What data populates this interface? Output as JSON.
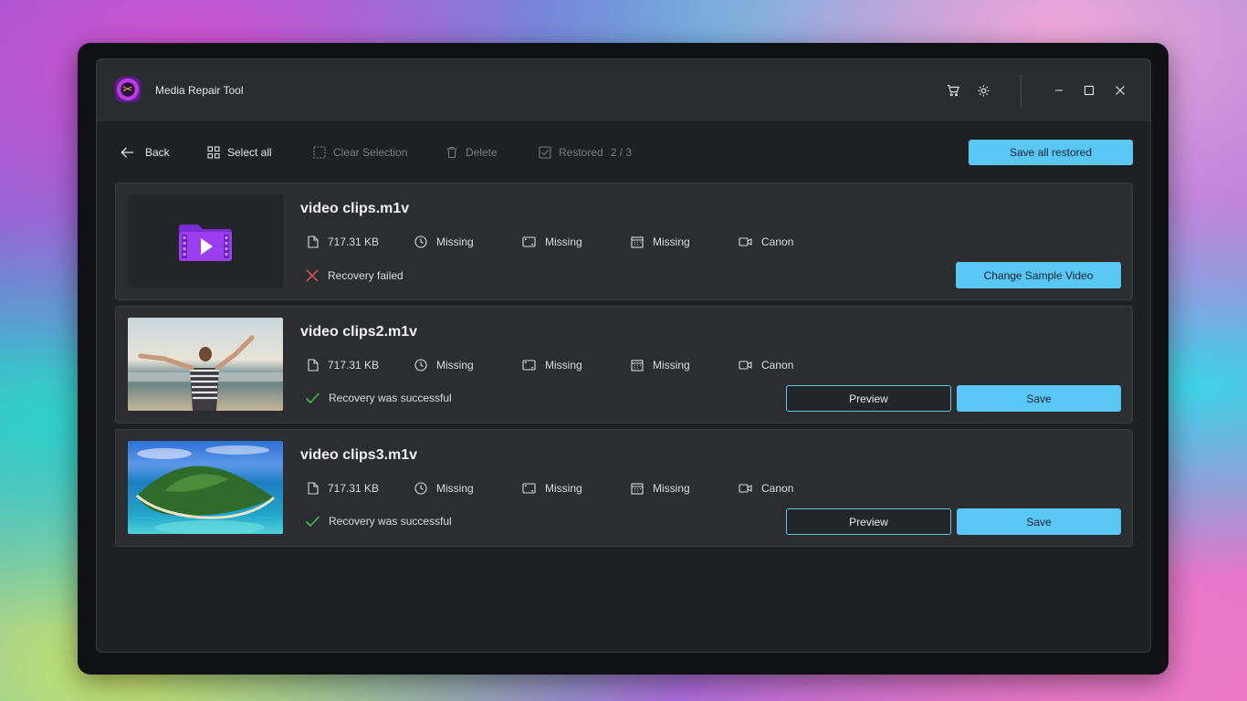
{
  "window": {
    "title": "Media Repair Tool"
  },
  "toolbar": {
    "back_label": "Back",
    "select_all_label": "Select all",
    "clear_selection_label": "Clear Selection",
    "delete_label": "Delete",
    "restored_label": "Restored",
    "restored_count": "2 / 3",
    "save_all_label": "Save all restored"
  },
  "files": [
    {
      "name": "video clips.m1v",
      "size": "717.31 KB",
      "duration": "Missing",
      "resolution": "Missing",
      "date": "Missing",
      "camera": "Canon",
      "status": "Recovery failed",
      "action_label": "Change Sample Video"
    },
    {
      "name": "video clips2.m1v",
      "size": "717.31 KB",
      "duration": "Missing",
      "resolution": "Missing",
      "date": "Missing",
      "camera": "Canon",
      "status": "Recovery was successful",
      "preview_label": "Preview",
      "save_label": "Save"
    },
    {
      "name": "video clips3.m1v",
      "size": "717.31 KB",
      "duration": "Missing",
      "resolution": "Missing",
      "date": "Missing",
      "camera": "Canon",
      "status": "Recovery was successful",
      "preview_label": "Preview",
      "save_label": "Save"
    }
  ],
  "colors": {
    "accent": "#59c8f7",
    "success": "#3fbf4a",
    "error": "#e0565a",
    "window_bg": "#1f2022",
    "card_bg": "#2c2d30"
  },
  "icons": [
    "app-logo-icon",
    "cart-icon",
    "settings-gear-icon",
    "minimize-icon",
    "maximize-icon",
    "close-icon",
    "back-arrow-icon",
    "select-all-icon",
    "clear-selection-icon",
    "trash-icon",
    "checkbox-icon",
    "file-icon",
    "clock-icon",
    "resolution-icon",
    "calendar-icon",
    "video-camera-icon",
    "x-mark-icon",
    "checkmark-icon",
    "video-folder-icon"
  ]
}
